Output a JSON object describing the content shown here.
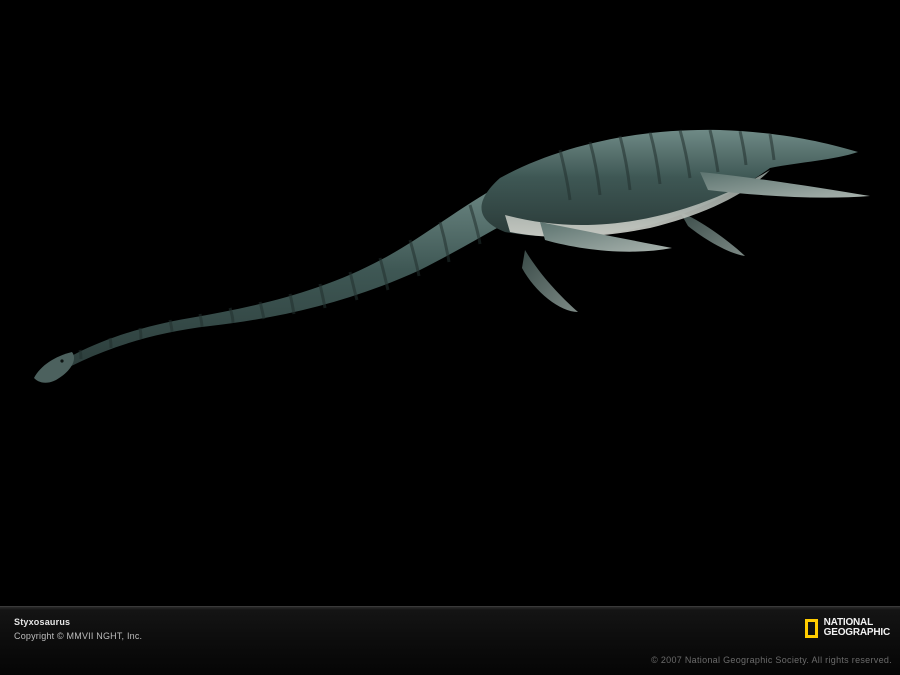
{
  "caption": {
    "title": "Styxosaurus",
    "copyright": "Copyright © MMVII NGHT, Inc."
  },
  "brand": {
    "line1": "NATIONAL",
    "line2": "GEOGRAPHIC",
    "accent_color": "#ffcc00"
  },
  "rights": "© 2007 National Geographic Society. All rights reserved.",
  "colors": {
    "background": "#000000",
    "body_dark": "#3b5552",
    "body_light": "#7f9793",
    "belly": "#c9cbc3"
  }
}
